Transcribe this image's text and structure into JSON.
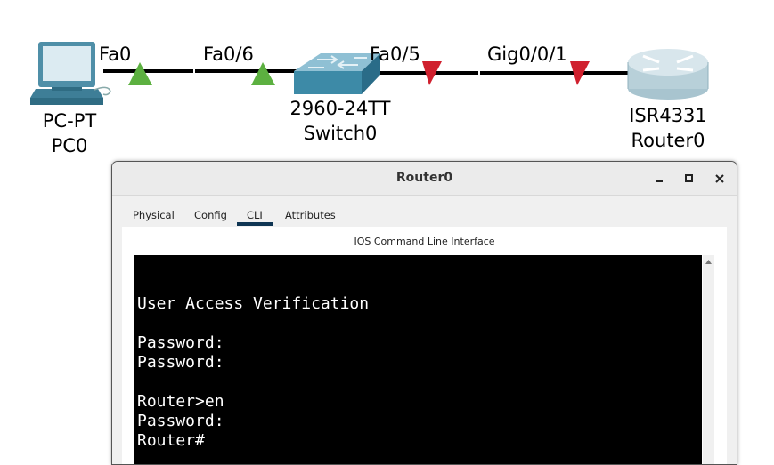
{
  "topology": {
    "links": [
      {
        "port_a": "Fa0",
        "port_b": "Fa0/6",
        "status": "up"
      },
      {
        "port_a": "Fa0/5",
        "port_b": "Gig0/0/1",
        "status": "down"
      }
    ],
    "devices": [
      {
        "model": "PC-PT",
        "name": "PC0",
        "icon": "pc-icon"
      },
      {
        "model": "2960-24TT",
        "name": "Switch0",
        "icon": "switch-icon"
      },
      {
        "model": "ISR4331",
        "name": "Router0",
        "icon": "router-icon"
      }
    ],
    "colors": {
      "link_up": "#5cb040",
      "link_down": "#d0202e",
      "link": "#000000"
    }
  },
  "window": {
    "title": "Router0",
    "tabs": [
      {
        "label": "Physical",
        "active": false
      },
      {
        "label": "Config",
        "active": false
      },
      {
        "label": "CLI",
        "active": true
      },
      {
        "label": "Attributes",
        "active": false
      }
    ],
    "cli_title": "IOS Command Line Interface",
    "console_lines": [
      "",
      "",
      "User Access Verification",
      "",
      "Password:",
      "Password:",
      "",
      "Router>en",
      "Password:",
      "Router#"
    ],
    "colors": {
      "active_tab_underline": "#0f3553",
      "console_bg": "#000000",
      "console_fg": "#ffffff"
    }
  }
}
